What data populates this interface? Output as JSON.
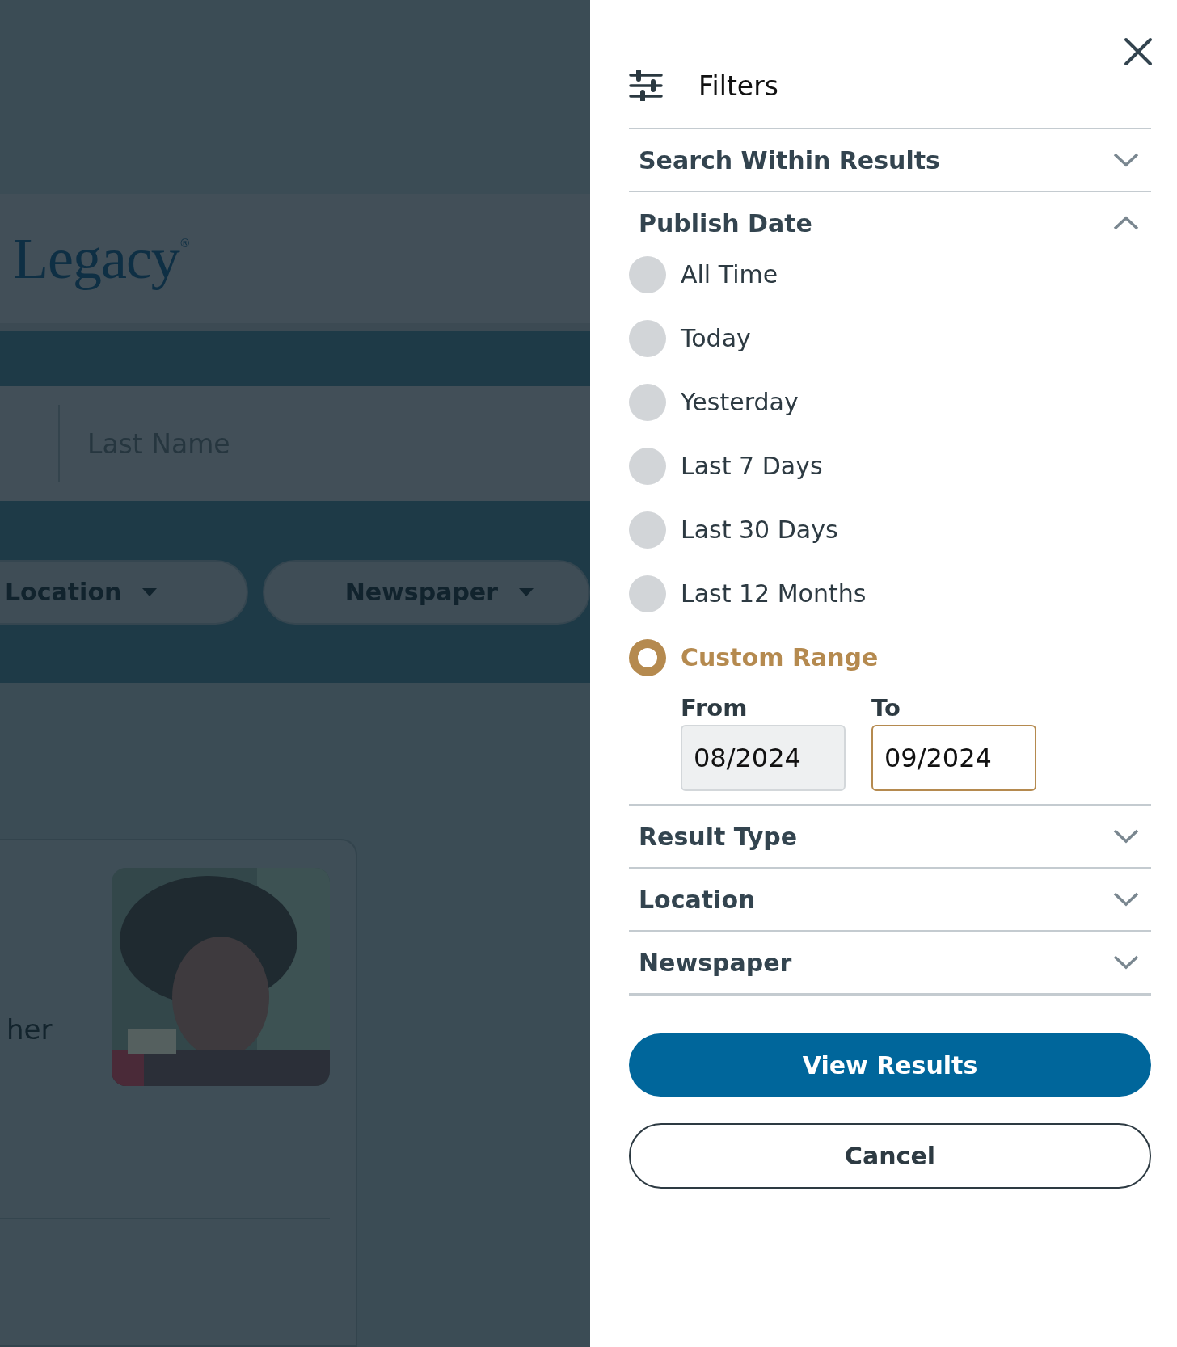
{
  "page": {
    "logo": "Legacy$^{®}$",
    "search": {
      "placeholder": "Last Name"
    },
    "filter_pills": [
      {
        "label": "Location"
      },
      {
        "label": "Newspaper"
      }
    ],
    "result_card": {
      "snippet": "her"
    }
  },
  "filters_panel": {
    "title": "Filters",
    "sections": [
      {
        "title": "Search Within Results",
        "expanded": false
      },
      {
        "title": "Publish Date",
        "expanded": true,
        "options": [
          {
            "label": "All Time",
            "selected": false
          },
          {
            "label": "Today",
            "selected": false
          },
          {
            "label": "Yesterday",
            "selected": false
          },
          {
            "label": "Last 7 Days",
            "selected": false
          },
          {
            "label": "Last 30 Days",
            "selected": false
          },
          {
            "label": "Last 12 Months",
            "selected": false
          },
          {
            "label": "Custom Range",
            "selected": true
          }
        ],
        "custom_range": {
          "from": {
            "label": "From",
            "value": "08/2024",
            "focused": false
          },
          "to": {
            "label": "To",
            "value": "09/2024",
            "focused": true
          }
        }
      },
      {
        "title": "Result Type",
        "expanded": false
      },
      {
        "title": "Location",
        "expanded": false
      },
      {
        "title": "Newspaper",
        "expanded": false
      }
    ],
    "buttons": [
      {
        "label": "View Results",
        "kind": "primary"
      },
      {
        "label": "Cancel",
        "kind": "secondary"
      }
    ]
  }
}
